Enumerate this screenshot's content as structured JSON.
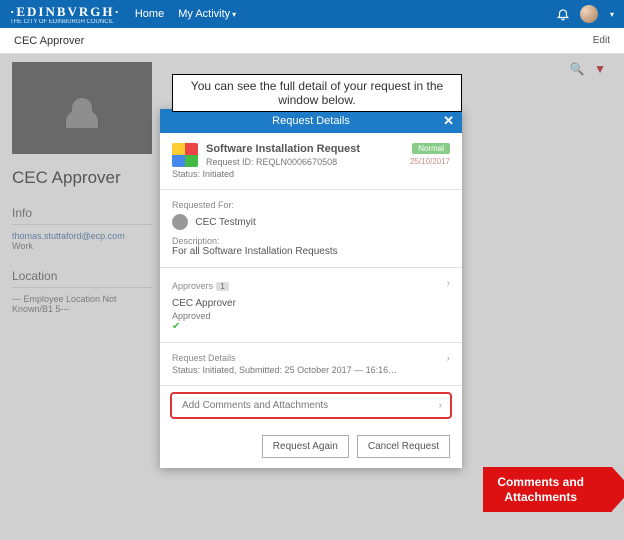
{
  "header": {
    "brand": "·EDINBVRGH·",
    "brand_sub": "THE CITY OF EDINBURGH COUNCIL",
    "nav_home": "Home",
    "nav_activity": "My Activity"
  },
  "subbar": {
    "title": "CEC Approver",
    "edit": "Edit"
  },
  "profile": {
    "name": "CEC Approver",
    "info_h": "Info",
    "email": "thomas.stuttaford@ecp.com",
    "email_label": "Work",
    "loc_h": "Location",
    "loc_line": "--- Employee Location Not Known/B1 5---"
  },
  "callout": {
    "text": "You can see the full detail of your request in the window below."
  },
  "modal": {
    "title": "Request Details",
    "type_label": "Software Installation Request",
    "badge": "Normal",
    "request_id": "Request ID: REQLN0006670508",
    "status_line": "Status: Initiated",
    "date": "25/10/2017",
    "req_for_label": "Requested For:",
    "req_for_val": "CEC Testmyit",
    "desc_label": "Description:",
    "desc_val": "For all Software Installation Requests",
    "approvers_label": "Approvers",
    "approvers_count": "1",
    "approver_name": "CEC Approver",
    "approver_status": "Approved",
    "details_label": "Request Details",
    "details_val": "Status: Initiated, Submitted: 25 October 2017 — 16:16…",
    "add_comments": "Add Comments and Attachments",
    "btn_again": "Request Again",
    "btn_cancel": "Cancel Request"
  },
  "arrow": {
    "l1": "Comments and",
    "l2": "Attachments"
  }
}
